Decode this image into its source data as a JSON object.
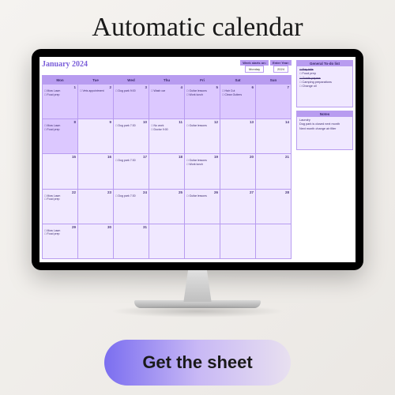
{
  "headline": "Automatic calendar",
  "cta_label": "Get the sheet",
  "calendar": {
    "title": "January 2024",
    "week_starts_label": "Week starts on:",
    "week_starts_value": "Monday",
    "year_label": "Enter Year:",
    "year_value": "2024",
    "days": [
      "Mon",
      "Tue",
      "Wed",
      "Thu",
      "Fri",
      "Sat",
      "Sun"
    ],
    "cells": [
      {
        "n": "1",
        "hl": true,
        "e": [
          "Mow Lawn",
          "Food prep"
        ]
      },
      {
        "n": "2",
        "hl": true,
        "e": [
          "Vets appointment"
        ]
      },
      {
        "n": "3",
        "hl": true,
        "e": [
          "Dog park 9:00"
        ]
      },
      {
        "n": "4",
        "hl": true,
        "e": [
          "Wash car"
        ]
      },
      {
        "n": "5",
        "hl": true,
        "e": [
          "Guitar lessons",
          "Work lunch"
        ]
      },
      {
        "n": "6",
        "hl": true,
        "e": [
          "Hair Cut",
          "Clean Gutters"
        ]
      },
      {
        "n": "7",
        "hl": true,
        "e": []
      },
      {
        "n": "8",
        "hl": true,
        "e": [
          "Mow Lawn",
          "Food prep"
        ]
      },
      {
        "n": "9",
        "e": []
      },
      {
        "n": "10",
        "e": [
          "Dog park 7:30"
        ]
      },
      {
        "n": "11",
        "e": [
          "No work",
          "Doctor 9:00"
        ]
      },
      {
        "n": "12",
        "e": [
          "Guitar lessons"
        ]
      },
      {
        "n": "13",
        "e": []
      },
      {
        "n": "14",
        "e": []
      },
      {
        "n": "15",
        "e": []
      },
      {
        "n": "16",
        "e": []
      },
      {
        "n": "17",
        "e": [
          "Dog park 7:30"
        ]
      },
      {
        "n": "18",
        "e": []
      },
      {
        "n": "19",
        "e": [
          "Guitar lessons",
          "Work lunch"
        ]
      },
      {
        "n": "20",
        "e": []
      },
      {
        "n": "21",
        "e": []
      },
      {
        "n": "22",
        "e": [
          "Mow Lawn",
          "Food prep"
        ]
      },
      {
        "n": "23",
        "e": []
      },
      {
        "n": "24",
        "e": [
          "Dog park 7:30"
        ]
      },
      {
        "n": "25",
        "e": []
      },
      {
        "n": "26",
        "e": [
          "Guitar lessons"
        ]
      },
      {
        "n": "27",
        "e": []
      },
      {
        "n": "28",
        "e": []
      },
      {
        "n": "29",
        "e": [
          "Mow Lawn",
          "Food prep"
        ]
      },
      {
        "n": "30",
        "e": []
      },
      {
        "n": "31",
        "e": []
      },
      {
        "n": "",
        "e": []
      },
      {
        "n": "",
        "e": []
      },
      {
        "n": "",
        "e": []
      },
      {
        "n": "",
        "e": []
      }
    ]
  },
  "todo": {
    "title": "General To-do list",
    "items": [
      {
        "label": "Pay bills",
        "done": true
      },
      {
        "label": "Food prep",
        "done": false
      },
      {
        "label": "Grade papers",
        "done": true
      },
      {
        "label": "Camping preparations",
        "done": false
      },
      {
        "label": "Change oil",
        "done": false
      }
    ]
  },
  "notes": {
    "title": "Notes",
    "items": [
      "Laundry",
      "Dog park is closed next month",
      "Next month change air filter"
    ]
  }
}
